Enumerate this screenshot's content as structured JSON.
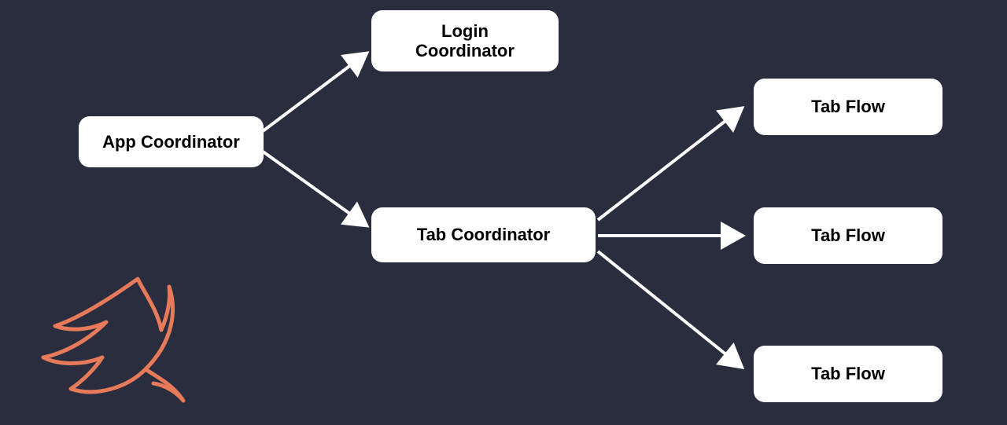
{
  "nodes": {
    "app_coordinator": {
      "label": "App Coordinator"
    },
    "login_coordinator": {
      "label": "Login\nCoordinator"
    },
    "tab_coordinator": {
      "label": "Tab Coordinator"
    },
    "tab_flow_1": {
      "label": "Tab Flow"
    },
    "tab_flow_2": {
      "label": "Tab Flow"
    },
    "tab_flow_3": {
      "label": "Tab Flow"
    }
  },
  "edges": [
    {
      "from": "app_coordinator",
      "to": "login_coordinator"
    },
    {
      "from": "app_coordinator",
      "to": "tab_coordinator"
    },
    {
      "from": "tab_coordinator",
      "to": "tab_flow_1"
    },
    {
      "from": "tab_coordinator",
      "to": "tab_flow_2"
    },
    {
      "from": "tab_coordinator",
      "to": "tab_flow_3"
    }
  ],
  "colors": {
    "background": "#2a2d3e",
    "node_bg": "#ffffff",
    "node_text": "#000000",
    "arrow": "#ffffff",
    "logo": "#e67a5a"
  }
}
